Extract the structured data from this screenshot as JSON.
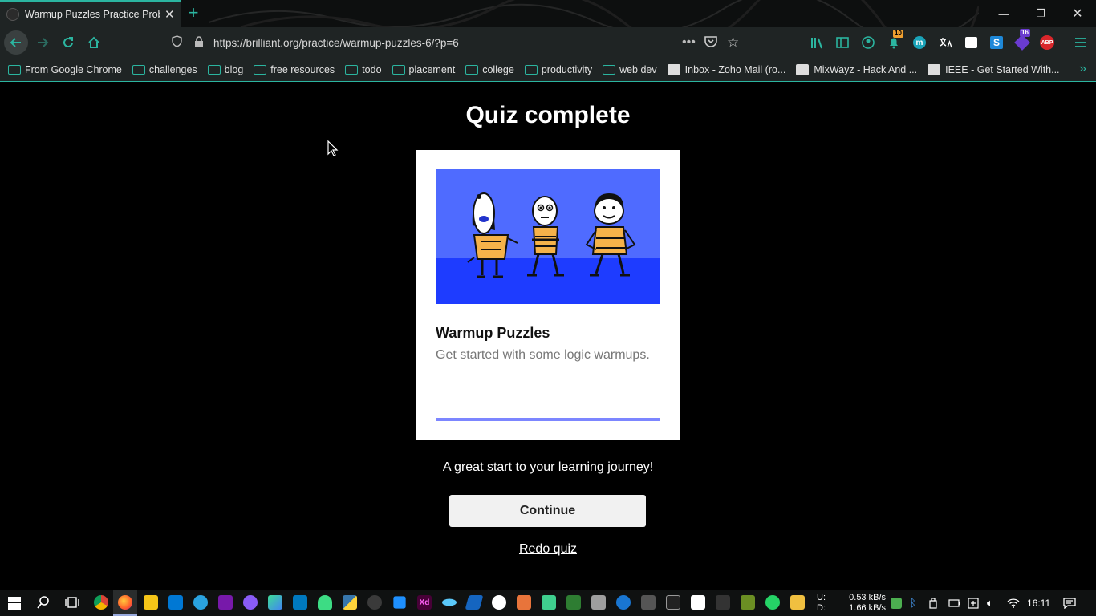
{
  "browser": {
    "tab_title": "Warmup Puzzles Practice Probl",
    "new_tab_label": "+",
    "url": "https://brilliant.org/practice/warmup-puzzles-6/?p=6",
    "toolbar_badges": {
      "notifications": "10",
      "extensions": "16",
      "adblock": "ABP"
    }
  },
  "bookmarks": [
    {
      "label": "From Google Chrome",
      "type": "folder"
    },
    {
      "label": "challenges",
      "type": "folder"
    },
    {
      "label": "blog",
      "type": "folder"
    },
    {
      "label": "free resources",
      "type": "folder"
    },
    {
      "label": "todo",
      "type": "folder"
    },
    {
      "label": "placement",
      "type": "folder"
    },
    {
      "label": "college",
      "type": "folder"
    },
    {
      "label": "productivity",
      "type": "folder"
    },
    {
      "label": "web dev",
      "type": "folder"
    },
    {
      "label": "Inbox - Zoho Mail (ro...",
      "type": "site"
    },
    {
      "label": "MixWayz - Hack And ...",
      "type": "site"
    },
    {
      "label": "IEEE - Get Started With...",
      "type": "site"
    }
  ],
  "quiz": {
    "heading": "Quiz complete",
    "card_title": "Warmup Puzzles",
    "card_description": "Get started with some logic warmups.",
    "progress": 1.0,
    "tagline": "A great start to your learning journey!",
    "continue_label": "Continue",
    "redo_label": "Redo quiz"
  },
  "taskbar": {
    "upload_label": "U:",
    "download_label": "D:",
    "upload_speed": "0.53 kB/s",
    "download_speed": "1.66 kB/s",
    "clock": "16:11"
  },
  "colors": {
    "accent": "#2bb5a0",
    "art_sky": "#4f6bff",
    "art_ground": "#1e3cff",
    "progress_fill": "#7c86ff"
  }
}
